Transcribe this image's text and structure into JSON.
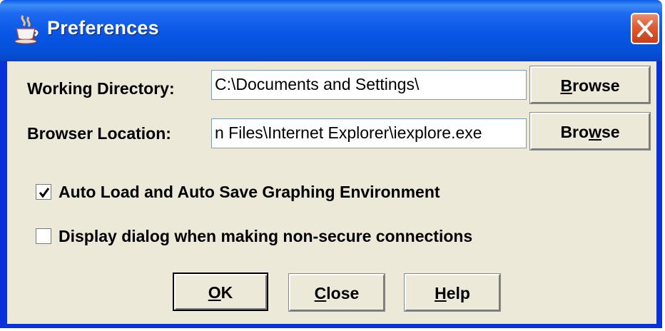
{
  "window": {
    "title": "Preferences",
    "accent": "#0856e4",
    "close_color": "#e0592f"
  },
  "working_directory": {
    "label": "Working Directory:",
    "value": "C:\\Documents and Settings\\",
    "browse_label": "Browse"
  },
  "browser_location": {
    "label": "Browser Location:",
    "value": "n Files\\Internet Explorer\\iexplore.exe",
    "browse_label": "Browse"
  },
  "options": [
    {
      "label": "Auto Load and Auto Save Graphing Environment",
      "checked": true
    },
    {
      "label": "Display dialog when making non-secure connections",
      "checked": false
    }
  ],
  "buttons": {
    "ok": "OK",
    "close": "Close",
    "help": "Help"
  },
  "icons": {
    "title": "java-cup-icon",
    "close": "close-x-icon"
  }
}
